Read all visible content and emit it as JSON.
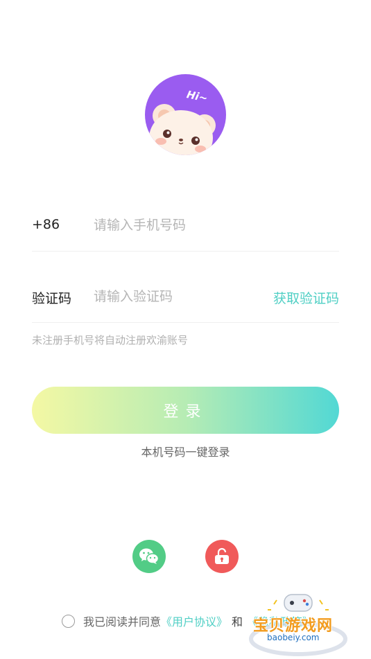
{
  "form": {
    "phone_prefix": "+86",
    "phone_placeholder": "请输入手机号码",
    "code_label": "验证码",
    "code_placeholder": "请输入验证码",
    "get_code_label": "获取验证码",
    "hint": "未注册手机号将自动注册欢渝账号"
  },
  "avatar": {
    "greeting": "Hi~"
  },
  "buttons": {
    "login_label": "登录",
    "one_click_label": "本机号码一键登录"
  },
  "social": {
    "wechat_icon": "wechat-icon",
    "lock_icon": "unlock-icon"
  },
  "agreement": {
    "prefix": "我已阅读并同意",
    "user_agreement": "《用户协议》",
    "and": "和",
    "privacy_policy": "《隐私政策》"
  },
  "watermark": {
    "title": "宝贝游戏网",
    "url": "baobeiy.com"
  },
  "colors": {
    "accent": "#4fcfc4",
    "avatar_bg": "#9a5cf0",
    "wechat": "#52cc86",
    "lock": "#f05a5a",
    "gradient_start": "#f4f8a4",
    "gradient_end": "#52d8d4"
  }
}
